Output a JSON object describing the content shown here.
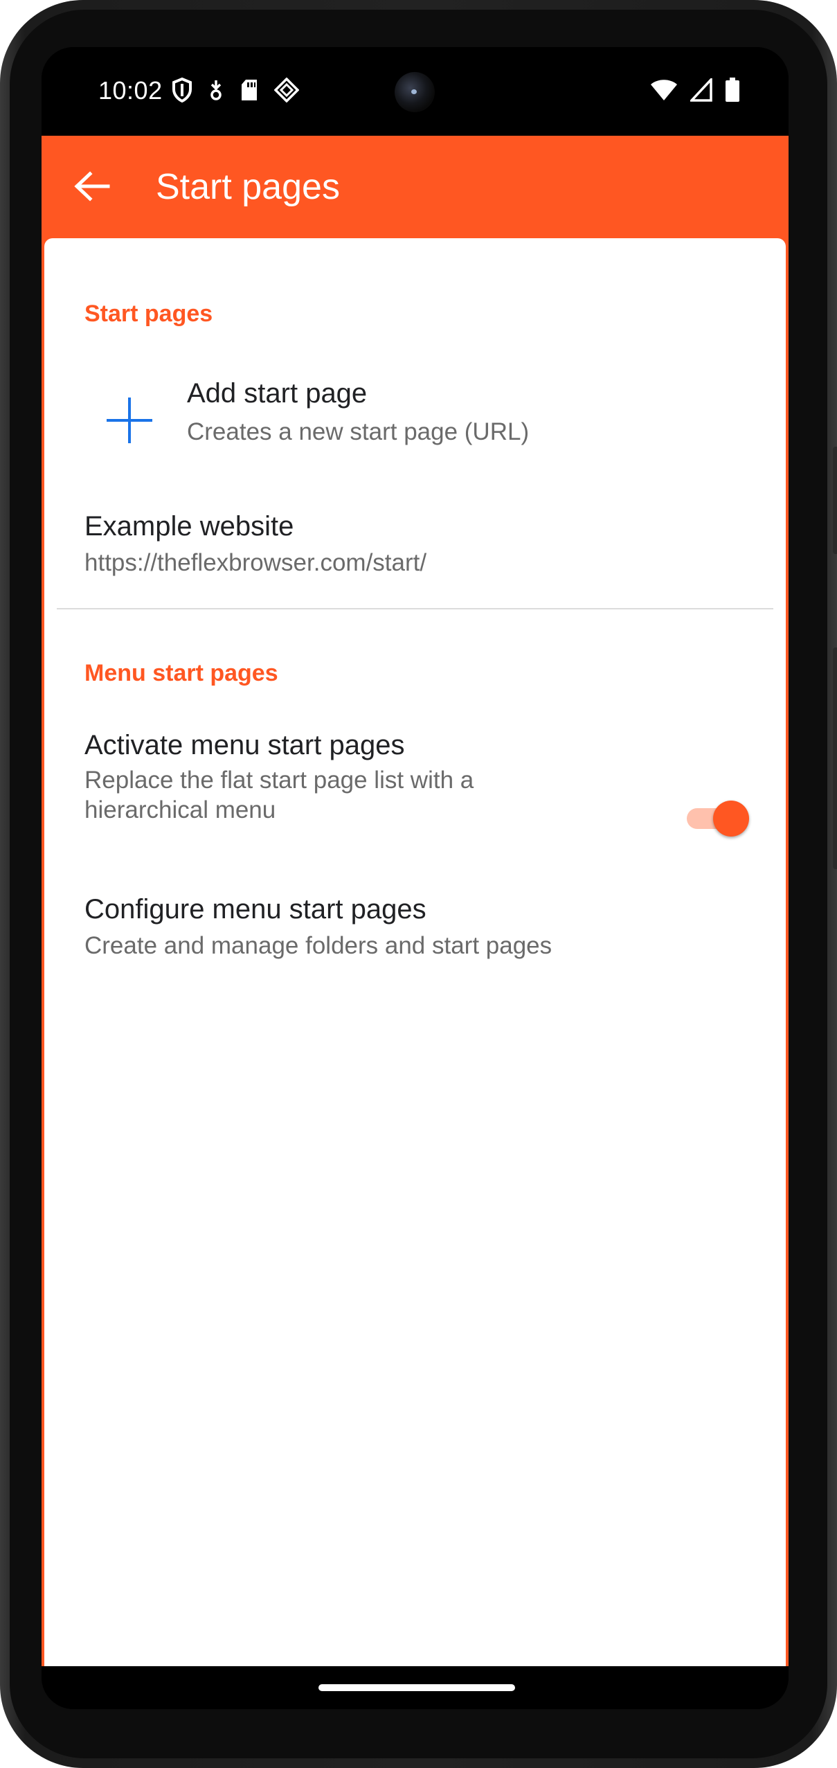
{
  "status_bar": {
    "time": "10:02",
    "left_icons": [
      "shield-icon",
      "download-icon",
      "sd-card-icon",
      "app-diamond-icon"
    ],
    "right_icons": [
      "wifi-icon",
      "signal-icon",
      "battery-icon"
    ]
  },
  "app_bar": {
    "title": "Start pages",
    "back_icon": "arrow-back-icon"
  },
  "colors": {
    "accent": "#ff5722",
    "switch_track": "#ffc1ad",
    "plus_icon": "#1a73e8"
  },
  "sections": {
    "start_pages": {
      "header": "Start pages",
      "add": {
        "title": "Add start page",
        "summary": "Creates a new start page (URL)",
        "icon": "plus-icon"
      },
      "example": {
        "title": "Example website",
        "summary": "https://theflexbrowser.com/start/"
      }
    },
    "menu_start_pages": {
      "header": "Menu start pages",
      "activate": {
        "title": "Activate menu start pages",
        "summary": "Replace the flat start page list with a hierarchical menu",
        "checked": true
      },
      "configure": {
        "title": "Configure menu start pages",
        "summary": "Create and manage folders and start pages"
      }
    }
  }
}
